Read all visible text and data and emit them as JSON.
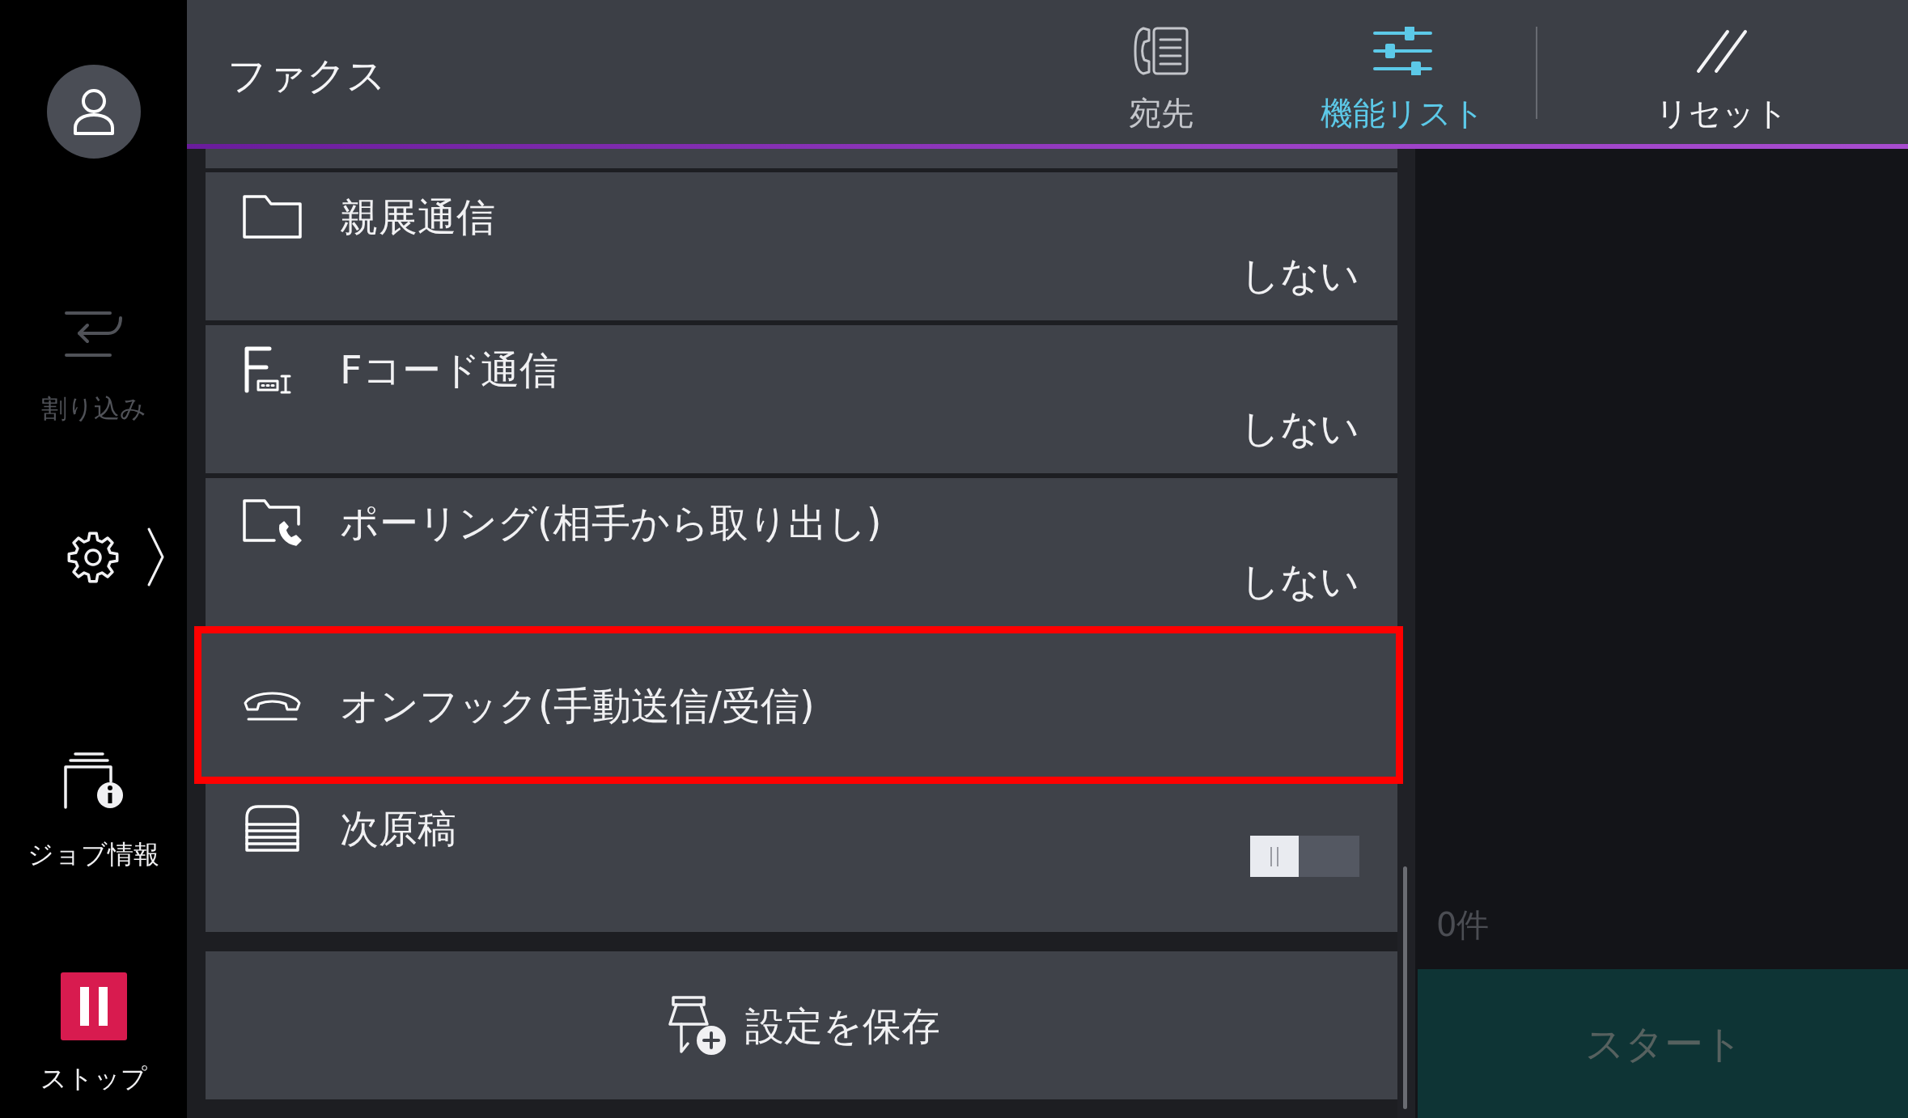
{
  "sidebar": {
    "interrupt": {
      "label": "割り込み",
      "disabled": true
    },
    "job_info": {
      "label": "ジョブ情報"
    },
    "stop": {
      "label": "ストップ"
    }
  },
  "header": {
    "title": "ファクス",
    "tabs": [
      {
        "label": "宛先",
        "selected": false
      },
      {
        "label": "機能リスト",
        "selected": true
      }
    ],
    "reset": {
      "label": "リセット"
    }
  },
  "features": [
    {
      "kind": "value",
      "label": "親展通信",
      "value": "しない",
      "highlighted": false
    },
    {
      "kind": "value",
      "label": "Fコード通信",
      "value": "しない",
      "highlighted": false
    },
    {
      "kind": "value",
      "label": "ポーリング(相手から取り出し)",
      "value": "しない",
      "highlighted": false
    },
    {
      "kind": "action",
      "label": "オンフック(手動送信/受信)",
      "highlighted": true
    },
    {
      "kind": "toggle",
      "label": "次原稿",
      "on": false,
      "highlighted": false
    }
  ],
  "save_button": {
    "label": "設定を保存"
  },
  "job_count": "0件",
  "start_button": {
    "label": "スタート",
    "disabled": true
  }
}
